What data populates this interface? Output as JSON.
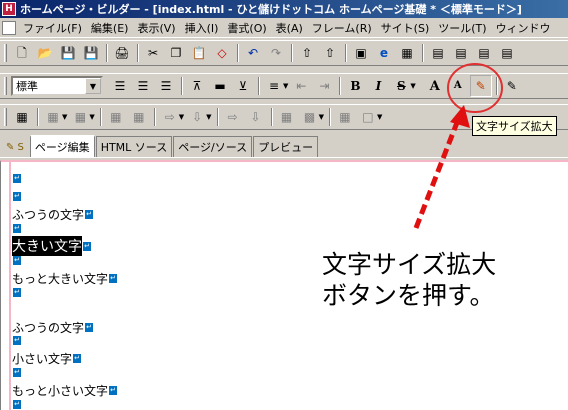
{
  "window": {
    "title": "ホームページ・ビルダー - [index.html - ひと儲けドットコム ホームページ基礎 * ＜標準モード＞]"
  },
  "menu": [
    "ファイル(F)",
    "編集(E)",
    "表示(V)",
    "挿入(I)",
    "書式(O)",
    "表(A)",
    "フレーム(R)",
    "サイト(S)",
    "ツール(T)",
    "ウィンドウ"
  ],
  "format_toolbar": {
    "style_value": "標準",
    "bold": "B",
    "italic": "I",
    "strike": "S",
    "font_up": "A",
    "font_down": "A"
  },
  "tooltip": "文字サイズ拡大",
  "tabs": [
    "ページ編集",
    "HTML ソース",
    "ページ/ソース",
    "プレビュー"
  ],
  "editor": {
    "lines": [
      "",
      "",
      "ふつうの文字",
      "",
      "大きい文字",
      "",
      "もっと大きい文字",
      "",
      "ふつうの文字",
      "",
      "小さい文字",
      "",
      "もっと小さい文字",
      ""
    ]
  },
  "annotation": {
    "line1": "文字サイズ拡大",
    "line2": "ボタンを押す。"
  },
  "colors": {
    "title_start": "#0a246a",
    "title_end": "#3a6ea5",
    "arrow": "#e01010",
    "circle": "#e03030",
    "editor_border": "#f5b7c8"
  }
}
